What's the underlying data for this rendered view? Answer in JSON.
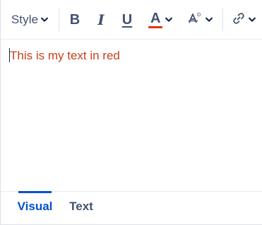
{
  "toolbar": {
    "style_label": "Style",
    "bold_label": "B",
    "italic_label": "I",
    "underline_label": "U",
    "text_color_label": "A",
    "text_color_value": "#de350b",
    "icons": {
      "style_dropdown": "chevron-down-icon",
      "text_color_dropdown": "chevron-down-icon",
      "more_formatting": "clear-formatting-icon",
      "link": "link-icon"
    }
  },
  "content": {
    "text": "This is my text in red",
    "text_color": "#c4421f"
  },
  "tabs": [
    {
      "label": "Visual",
      "active": true
    },
    {
      "label": "Text",
      "active": false
    }
  ],
  "colors": {
    "accent": "#0052cc",
    "icon": "#42526e",
    "border": "#dfe1e6"
  }
}
